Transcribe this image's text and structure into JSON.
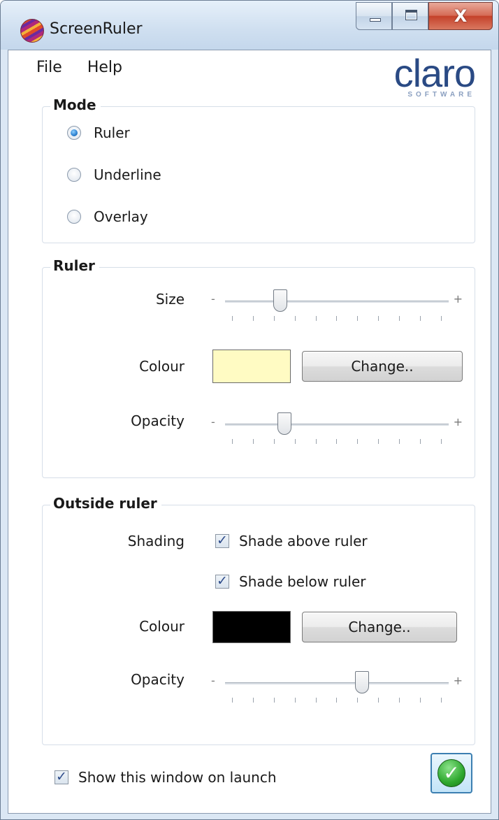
{
  "window": {
    "title": "ScreenRuler",
    "controls": {
      "minimize": "minimize-icon",
      "maximize": "maximize-icon",
      "close": "close-icon",
      "close_glyph": "X"
    }
  },
  "menu": {
    "file": "File",
    "help": "Help"
  },
  "logo": {
    "word": "claro",
    "sub": "SOFTWARE"
  },
  "mode": {
    "title": "Mode",
    "options": [
      "Ruler",
      "Underline",
      "Overlay"
    ],
    "selected": "Ruler"
  },
  "ruler": {
    "title": "Ruler",
    "size_label": "Size",
    "size_value": 0.23,
    "colour_label": "Colour",
    "colour": "#fffbc3",
    "change_label": "Change..",
    "opacity_label": "Opacity",
    "opacity_value": 0.25
  },
  "outside": {
    "title": "Outside ruler",
    "shading_label": "Shading",
    "shade_above": "Shade above ruler",
    "shade_above_checked": true,
    "shade_below": "Shade below ruler",
    "shade_below_checked": true,
    "colour_label": "Colour",
    "colour": "#000000",
    "change_label": "Change..",
    "opacity_label": "Opacity",
    "opacity_value": 0.62,
    "slider_minus": "-",
    "slider_plus": "+"
  },
  "footer": {
    "show_on_launch": "Show this window on launch",
    "show_on_launch_checked": true,
    "ok_icon": "check-icon"
  },
  "colors": {
    "accent": "#2a7fcf",
    "logo": "#2a4a84",
    "ok_green": "#2ea82e"
  }
}
